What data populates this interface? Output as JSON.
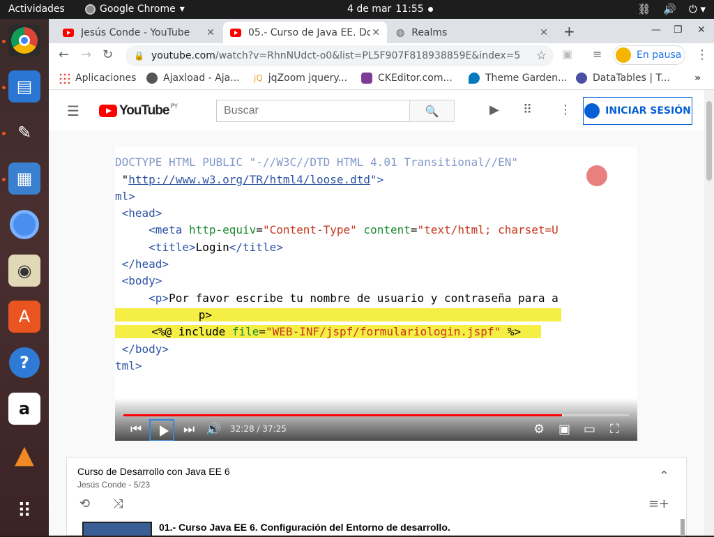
{
  "topbar": {
    "activities": "Actividades",
    "app_name": "Google Chrome",
    "date": "4 de mar",
    "time": "11:55"
  },
  "tabs": [
    {
      "label": "Jesús Conde - YouTube"
    },
    {
      "label": "05.- Curso de Java EE. Dor"
    },
    {
      "label": "Realms"
    }
  ],
  "toolbar": {
    "url_host": "youtube.com",
    "url_path": "/watch?v=RhnNUdct-o0&list=PL5F907F818938859E&index=5",
    "profile_status": "En pausa"
  },
  "bookmarks": [
    "Aplicaciones",
    "Ajaxload - Aja...",
    "jqZoom jquery...",
    "CKEditor.com...",
    "Theme Garden...",
    "DataTables | T..."
  ],
  "youtube": {
    "logo_text": "YouTube",
    "country_code": "PY",
    "search_placeholder": "Buscar",
    "signin_label": "INICIAR SESIÓN"
  },
  "video": {
    "code_lines": [
      "DOCTYPE HTML PUBLIC \"-//W3C//DTD HTML 4.01 Transitional//EN\"",
      " \"http://www.w3.org/TR/html4/loose.dtd\">",
      "ml>",
      " <head>",
      "     <meta http-equiv=\"Content-Type\" content=\"text/html; charset=U",
      "     <title>Login</title>",
      " </head>",
      " <body>",
      "     <p>Por favor escribe tu nombre de usuario y contraseña para a",
      "         p>",
      "  <%@ include file=\"WEB-INF/jspf/formulariologin.jspf\" %>",
      " </body>",
      "tml>"
    ],
    "time_display": "32:28 / 37:25",
    "progress_fraction": 0.867,
    "buffered_fraction": 0.87
  },
  "playlist": {
    "title": "Curso de Desarrollo con Java EE 6",
    "subtitle": "Jesús Conde - 5/23",
    "first_item": "01.- Curso Java EE 6. Configuración del Entorno de desarrollo."
  },
  "colors": {
    "youtube_red": "#ff0000",
    "link_blue": "#065fd4",
    "highlight": "#f5ee45"
  }
}
